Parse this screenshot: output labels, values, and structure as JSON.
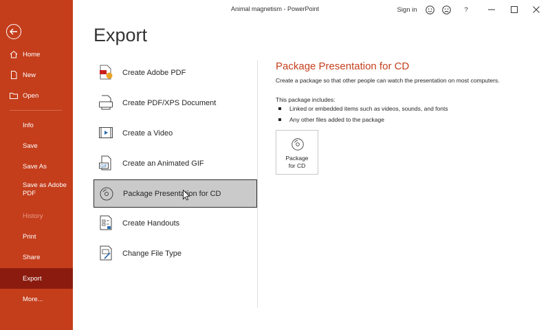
{
  "window": {
    "title": "Animal magnetism  -  PowerPoint",
    "sign_in": "Sign in",
    "help": "?"
  },
  "sidebar": {
    "items": [
      {
        "label": "Home"
      },
      {
        "label": "New"
      },
      {
        "label": "Open"
      },
      {
        "label": "Info"
      },
      {
        "label": "Save"
      },
      {
        "label": "Save As"
      },
      {
        "label": "Save as Adobe PDF"
      },
      {
        "label": "History"
      },
      {
        "label": "Print"
      },
      {
        "label": "Share"
      },
      {
        "label": "Export"
      },
      {
        "label": "More..."
      }
    ],
    "active": "Export",
    "disabled": "History"
  },
  "main": {
    "heading": "Export",
    "options": [
      {
        "label": "Create Adobe PDF",
        "icon": "adobe-pdf-icon"
      },
      {
        "label": "Create PDF/XPS Document",
        "icon": "pdf-xps-icon"
      },
      {
        "label": "Create a Video",
        "icon": "video-icon"
      },
      {
        "label": "Create an Animated GIF",
        "icon": "gif-icon"
      },
      {
        "label": "Package Presentation for CD",
        "icon": "cd-icon"
      },
      {
        "label": "Create Handouts",
        "icon": "handouts-icon"
      },
      {
        "label": "Change File Type",
        "icon": "change-file-type-icon"
      }
    ],
    "selected": "Package Presentation for CD"
  },
  "detail": {
    "title": "Package Presentation for CD",
    "description": "Create a package so that other people can watch the presentation on most computers.",
    "includes_label": "This package includes:",
    "bullets": [
      "Linked or embedded items such as videos, sounds, and fonts",
      "Any other files added to the package"
    ],
    "button_line1": "Package",
    "button_line2": "for CD"
  },
  "colors": {
    "accent": "#c43e1c",
    "sidebar_active": "#8b1b0f"
  }
}
